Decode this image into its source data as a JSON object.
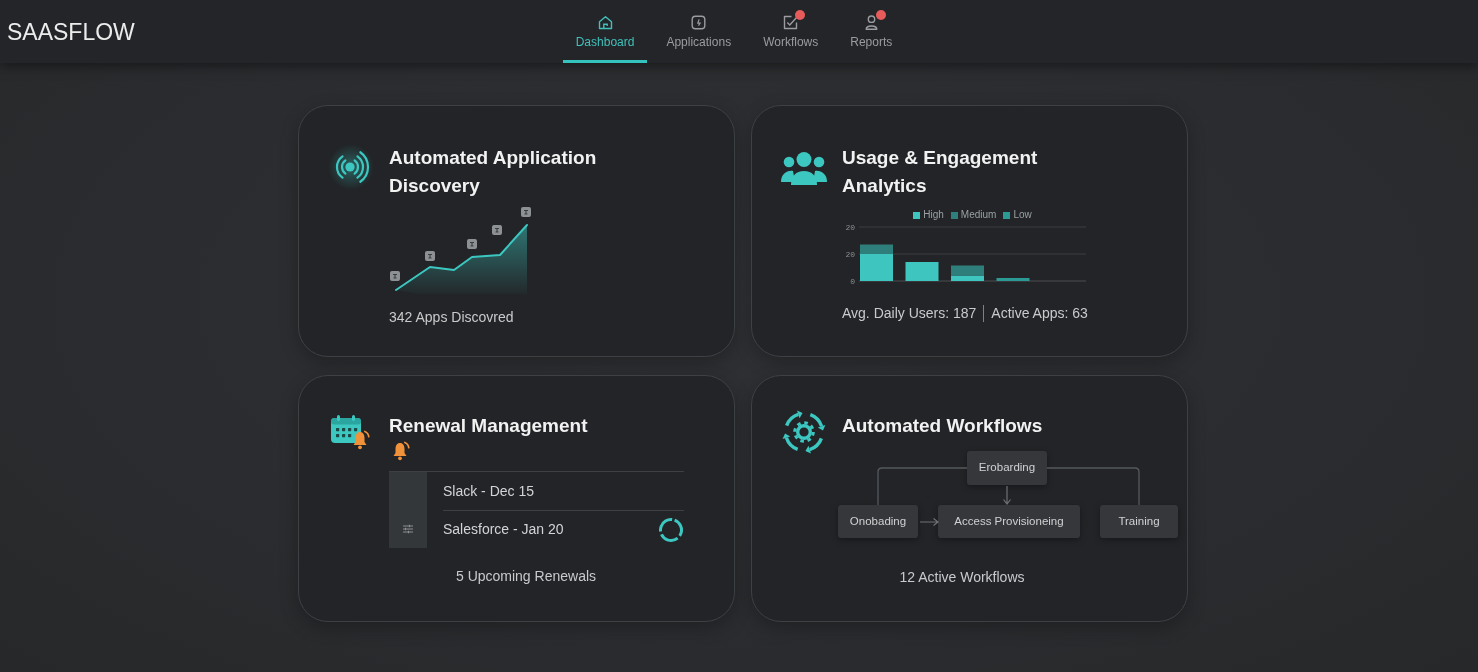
{
  "brand": {
    "name": "SAASFLOW"
  },
  "nav": {
    "tabs": [
      {
        "label": "Dashboard",
        "selected": true,
        "alert": false
      },
      {
        "label": "Applications",
        "selected": false,
        "alert": false
      },
      {
        "label": "Workflows",
        "selected": false,
        "alert": true
      },
      {
        "label": "Reports",
        "selected": false,
        "alert": true
      }
    ]
  },
  "cards": [
    {
      "kind": "discovery",
      "title": "Automated Application Discovery",
      "footer": "342 Apps Discovred"
    },
    {
      "kind": "analytics",
      "title": "Usage & Engagement Analytics",
      "chart": {
        "legend": [
          {
            "name": "High",
            "color": "#3fc5bf"
          },
          {
            "name": "Medium",
            "color": "#2e7f7b"
          },
          {
            "name": "Low",
            "color": "#2b9a95"
          }
        ],
        "axis_labels": [
          "20",
          "20",
          "0"
        ]
      },
      "stats": [
        "Avg. Daily Users: 187",
        "Active Apps: 63"
      ]
    },
    {
      "kind": "renewals",
      "title": "Renewal Management",
      "alert": true,
      "rows": [
        {
          "label": "Slack - Dec 15",
          "loading": false
        },
        {
          "label": "Salesforce - Jan 20",
          "loading": true
        }
      ],
      "footer": "5 Upcoming Renewals"
    },
    {
      "kind": "workflows",
      "title": "Automated Workflows",
      "nodes": [
        {
          "label": "Erobarding"
        },
        {
          "label": "Onobading"
        },
        {
          "label": "Access Provisioneing"
        },
        {
          "label": "Training"
        }
      ],
      "footer": "12 Active Workflows"
    }
  ]
}
